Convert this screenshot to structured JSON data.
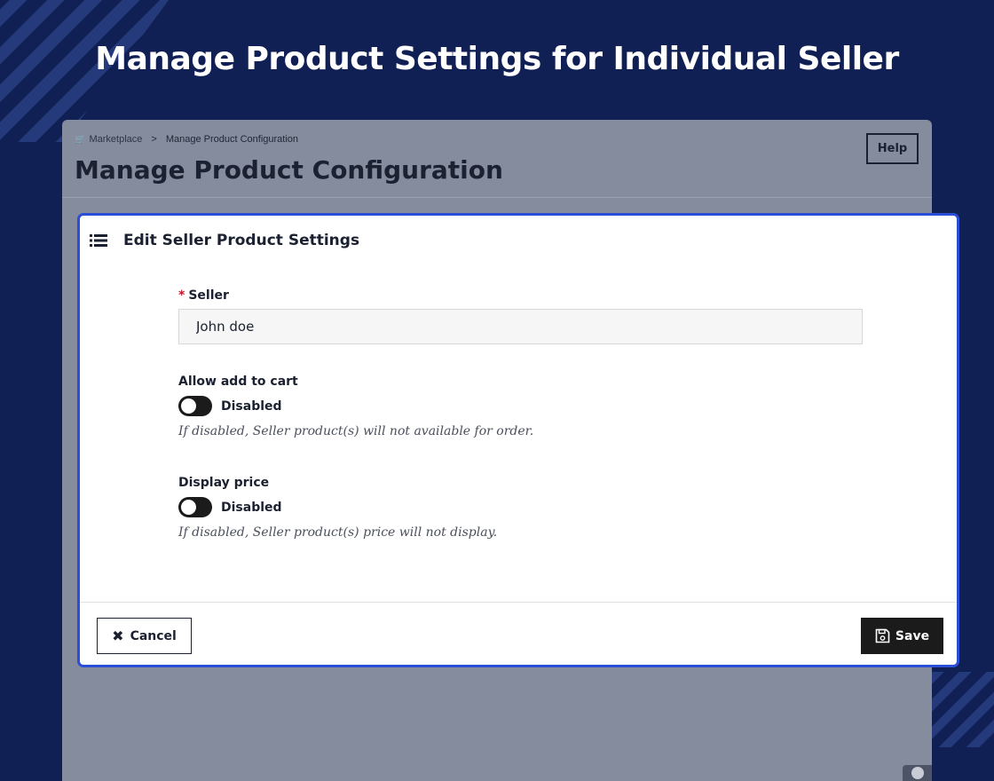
{
  "hero": {
    "title": "Manage Product Settings for Individual Seller"
  },
  "background_page": {
    "breadcrumb": {
      "root": "Marketplace",
      "separator": ">",
      "current": "Manage Product Configuration"
    },
    "title": "Manage Product Configuration",
    "help_label": "Help"
  },
  "modal": {
    "title": "Edit Seller Product Settings",
    "seller": {
      "required_mark": "*",
      "label": "Seller",
      "value": "John doe"
    },
    "allow_add_to_cart": {
      "label": "Allow add to cart",
      "state": "Disabled",
      "help": "If disabled, Seller product(s) will not available for order."
    },
    "display_price": {
      "label": "Display price",
      "state": "Disabled",
      "help": "If disabled, Seller product(s) price will not display."
    },
    "cancel_label": "Cancel",
    "save_label": "Save"
  },
  "icons": {
    "breadcrumb": "cart-icon",
    "modal_header": "list-icon",
    "cancel": "x-icon",
    "save": "floppy-disk-icon"
  },
  "colors": {
    "page_background": "#112054",
    "modal_border": "#2a4fd6",
    "required": "#c3152a",
    "button_dark": "#1b1b1b"
  }
}
